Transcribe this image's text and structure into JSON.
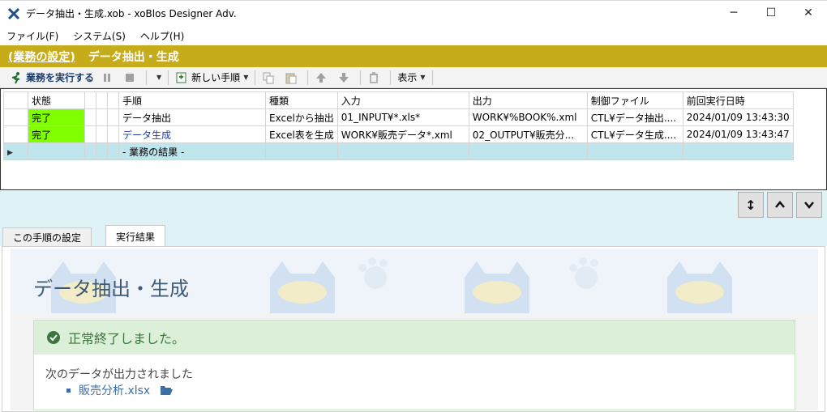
{
  "window": {
    "title": "データ抽出・生成.xob - xoBlos Designer Adv.",
    "min_glyph": "─",
    "max_glyph": "☐",
    "close_glyph": "✕"
  },
  "menu": [
    "ファイル(F)",
    "システム(S)",
    "ヘルプ(H)"
  ],
  "section": {
    "link": "(業務の設定)",
    "title": "データ抽出・生成"
  },
  "toolbar": {
    "run_label": "業務を実行する",
    "new_step_label": "新しい手順",
    "view_label": "表示"
  },
  "grid": {
    "headers": [
      "状態",
      "手順",
      "種類",
      "入力",
      "出力",
      "制御ファイル",
      "前回実行日時"
    ],
    "rows": [
      {
        "status": "完了",
        "step": "データ抽出",
        "kind": "Excelから抽出",
        "input": "01_INPUT¥*.xls*",
        "output": "WORK¥%BOOK%.xml",
        "control": "CTL¥データ抽出....",
        "last_run": "2024/01/09 13:43:30"
      },
      {
        "status": "完了",
        "step": "データ生成",
        "kind": "Excel表を生成",
        "input": "WORK¥販売データ*.xml",
        "output": "02_OUTPUT¥販売分...",
        "control": "CTL¥データ生成....",
        "last_run": "2024/01/09 13:43:47"
      }
    ],
    "result_row": "- 業務の結果 -"
  },
  "tabs": [
    "この手順の設定",
    "実行結果"
  ],
  "result": {
    "banner_title": "データ抽出・生成",
    "success": "正常終了しました。",
    "message": "次のデータが出力されました",
    "file": "販売分析.xlsx"
  },
  "colors": {
    "section_bar": "#c6ac1a",
    "status_done": "#7fff00",
    "result_row": "#bfe6ec",
    "success_bg": "#dcefd8"
  }
}
